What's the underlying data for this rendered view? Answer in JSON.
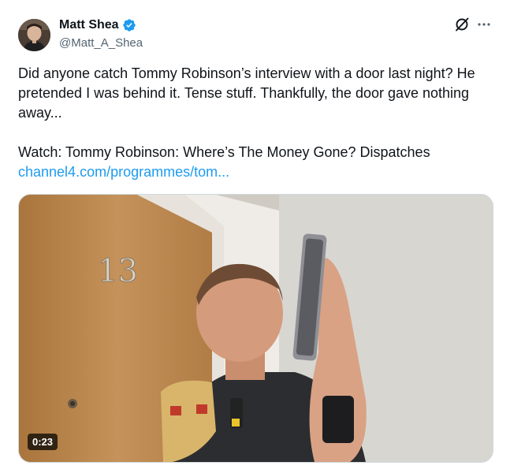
{
  "author": {
    "name": "Matt Shea",
    "handle": "@Matt_A_Shea",
    "verified": true,
    "verified_icon": "verified-badge-icon"
  },
  "header_actions": {
    "grok_icon": "grok-icon",
    "more_icon": "more-horizontal-icon"
  },
  "tweet": {
    "line1": "Did anyone catch Tommy Robinson’s interview with a door last night? He pretended I was behind it. Tense stuff. Thankfully, the door gave nothing away...",
    "line2": "Watch: Tommy Robinson: Where’s The Money Gone? Dispatches",
    "link_text": "channel4.com/programmes/tom..."
  },
  "media": {
    "type": "video",
    "duration": "0:23",
    "door_number": "13"
  },
  "colors": {
    "link": "#1d9bf0",
    "verified": "#1d9bf0",
    "secondary_text": "#536471"
  }
}
